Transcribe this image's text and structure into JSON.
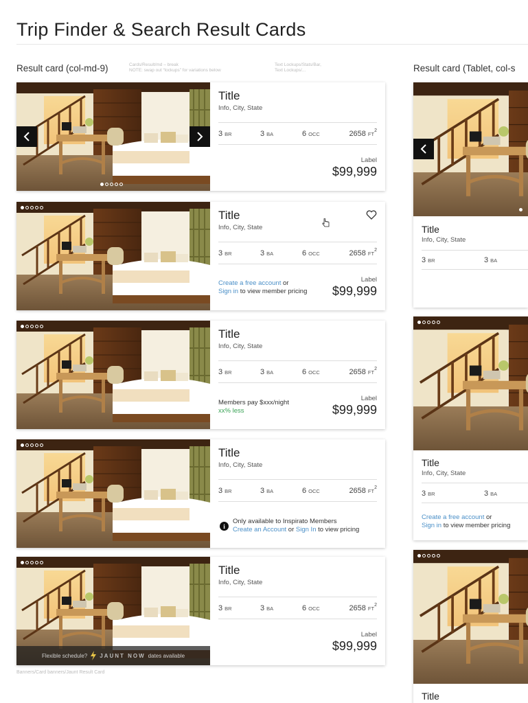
{
  "page": {
    "title": "Trip Finder & Search Result Cards"
  },
  "left_section": {
    "heading": "Result card (col-md-9)",
    "note1": "Cards/Result/md – break\nNOTE: swap out “lockups” for variations below",
    "note2": "Text Lockups/Stats/Bar,\nText Lockups/...",
    "footer_note": "Banners/Card banners/Jaunt Result Card"
  },
  "right_section": {
    "heading": "Result card (Tablet, col-s"
  },
  "card": {
    "title": "Title",
    "info": "Info, City, State",
    "br_val": "3",
    "br_unit": "BR",
    "ba_val": "3",
    "ba_unit": "BA",
    "occ_val": "6",
    "occ_unit": "OCC",
    "ft_val": "2658",
    "ft_unit": "FT",
    "ft_sup": "2",
    "price_label": "Label",
    "price": "$99,999"
  },
  "pricing_lock": {
    "create_link": "Create a free account",
    "or": " or",
    "signin_link": "Sign in",
    "suffix": " to view member pricing"
  },
  "members_pay": {
    "line1": "Members pay $xxx/night",
    "line2": "xx% less"
  },
  "members_only": {
    "line1": "Only available to Inspirato Members",
    "create_link": "Create an Account",
    "or": " or ",
    "signin_link": "Sign In",
    "suffix": " to view pricing"
  },
  "jaunt": {
    "prefix": "Flexible schedule?",
    "brand": "JAUNT NOW",
    "suffix": "dates available"
  },
  "carousel": {
    "count": 5,
    "active_index": 0
  },
  "icons": [
    "chevron-left-icon",
    "chevron-right-icon",
    "heart-icon",
    "info-icon",
    "lightning-icon",
    "hand-cursor-icon"
  ],
  "colors": {
    "link": "#4a8fc7",
    "green": "#3aa356",
    "arrow_bg": "#111111"
  }
}
